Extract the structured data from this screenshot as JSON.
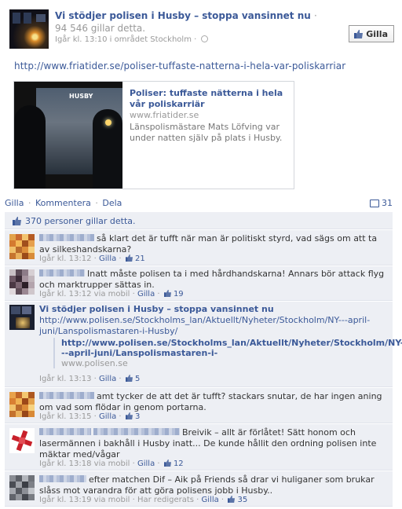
{
  "post": {
    "page_name": "Vi stödjer polisen i Husby – stoppa vansinnet nu",
    "title_dot": "·",
    "likes_text": "94 546 gillar detta.",
    "meta": "Igår kl. 13:10 i området Stockholm · ",
    "like_button": "Gilla",
    "url": "http://www.friatider.se/poliser-tuffaste-natterna-i-hela-var-poliskarriar"
  },
  "link_card": {
    "title": "Poliser: tuffaste nätterna i hela vår poliskarriär",
    "domain": "www.friatider.se",
    "description": "Länspolismästare Mats Löfving var under natten själv på plats i Husby.",
    "image_sign": "HUSBY"
  },
  "actions": {
    "like": "Gilla",
    "comment": "Kommentera",
    "share": "Dela",
    "separator": "·",
    "comment_count": "31"
  },
  "likers": {
    "text": "370 personer gillar detta."
  },
  "comments": [
    {
      "text": "så klart det är tufft när man är politiskt styrd, vad sägs om att ta av silkeshandskarna?",
      "time": "Igår kl. 13:12",
      "like": "Gilla",
      "likes": "21",
      "via": ""
    },
    {
      "text": "Inatt måste polisen ta i med hårdhandskarna! Annars bör attack flyg och marktrupper sättas in.",
      "time": "Igår kl. 13:12",
      "via": "via mobil",
      "like": "Gilla",
      "likes": "19"
    },
    {
      "author": "Vi stödjer polisen i Husby – stoppa vansinnet nu",
      "url": "http://www.polisen.se/Stockholms_lan/Aktuellt/Nyheter/Stockholm/NY---april-juni/Lanspolismastaren-i-Husby/",
      "inner_link": "http://www.polisen.se/Stockholms_lan/Aktuellt/Nyheter/Stockholm/NY---april-juni/Lanspolismastaren-i-",
      "inner_domain": "www.polisen.se",
      "time": "Igår kl. 13:13",
      "like": "Gilla",
      "likes": "5"
    },
    {
      "text": "amt tycker de att det är tufft? stackars snutar, de har ingen aning om vad som flödar in genom portarna.",
      "time": "Igår kl. 13:15",
      "like": "Gilla",
      "likes": "3"
    },
    {
      "text": "Breivik – allt är förlåtet! Sätt honom och lasermännen i bakhåll i Husby inatt... De kunde hållit den ordning polisen inte mäktar med/vågar",
      "time": "Igår kl. 13:18",
      "via": "via mobil",
      "like": "Gilla",
      "likes": "12"
    },
    {
      "text": "efter matchen Dif – Aik på Friends så drar vi huliganer som brukar slåss mot varandra för att göra polisens jobb i Husby..",
      "time": "Igår kl. 13:19",
      "via": "via mobil",
      "edited": "Har redigerats",
      "like": "Gilla",
      "likes": "35"
    }
  ],
  "colors": {
    "link": "#3b5998",
    "feed_bg": "#edeff4",
    "muted": "#999999"
  }
}
